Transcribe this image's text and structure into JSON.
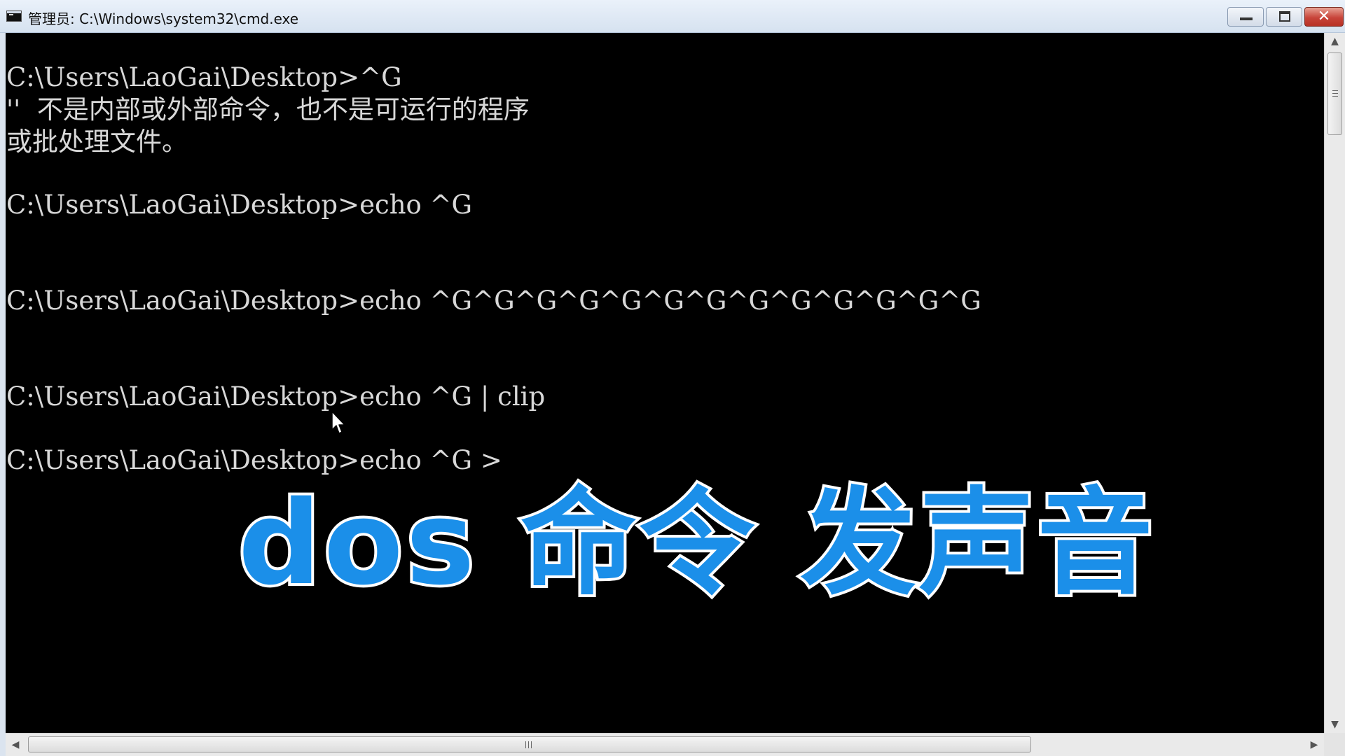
{
  "window": {
    "title": "管理员: C:\\Windows\\system32\\cmd.exe",
    "icon": "cmd-icon"
  },
  "controls": {
    "minimize_icon": "minimize-icon",
    "maximize_icon": "maximize-icon",
    "close_icon": "close-icon",
    "close_glyph": "✕"
  },
  "console": {
    "lines": [
      "C:\\Users\\LaoGai\\Desktop>^G",
      "''  不是内部或外部命令，也不是可运行的程序",
      "或批处理文件。",
      "C:\\Users\\LaoGai\\Desktop>echo ^G",
      "C:\\Users\\LaoGai\\Desktop>echo ^G^G^G^G^G^G^G^G^G^G^G^G^G",
      "C:\\Users\\LaoGai\\Desktop>echo ^G | clip",
      "C:\\Users\\LaoGai\\Desktop>echo ^G >"
    ]
  },
  "caption": {
    "text": "dos 命令 发声音",
    "fill_color": "#1b8fe9",
    "stroke_color": "#ffffff"
  },
  "scrollbars": {
    "up_arrow": "▲",
    "down_arrow": "▼",
    "left_arrow": "◀",
    "right_arrow": "▶"
  }
}
